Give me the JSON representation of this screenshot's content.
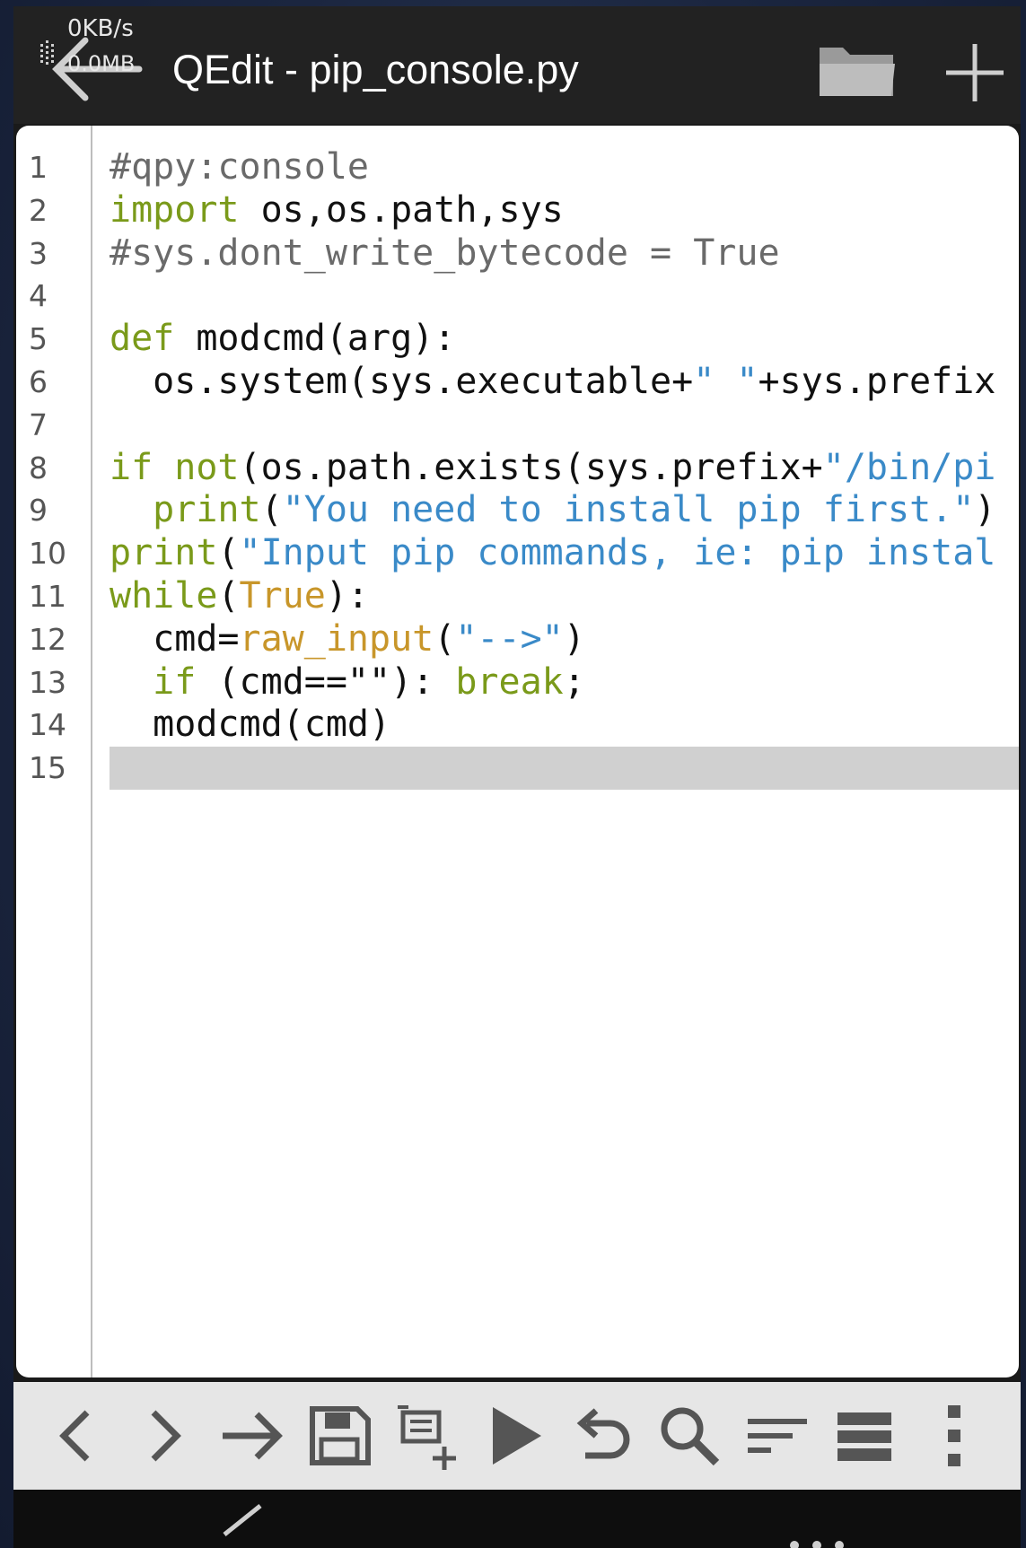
{
  "status": {
    "net_speed": "0KB/s",
    "net_total": "0.0MB"
  },
  "app": {
    "title": "QEdit - pip_console.py"
  },
  "icons": {
    "back": "back-arrow-icon",
    "folder": "folder-icon",
    "add": "plus-icon"
  },
  "editor": {
    "current_line": 15,
    "lines": [
      {
        "n": "1"
      },
      {
        "n": "2"
      },
      {
        "n": "3"
      },
      {
        "n": "4"
      },
      {
        "n": "5"
      },
      {
        "n": "6"
      },
      {
        "n": "7"
      },
      {
        "n": "8"
      },
      {
        "n": "9"
      },
      {
        "n": "10"
      },
      {
        "n": "11"
      },
      {
        "n": "12"
      },
      {
        "n": "13"
      },
      {
        "n": "14"
      },
      {
        "n": "15"
      }
    ],
    "code": {
      "l1_comment": "#qpy:console",
      "l2_kw": "import",
      "l2_rest": " os,os.path,sys",
      "l3_comment": "#sys.dont_write_bytecode = True",
      "l5_kw": "def",
      "l5_rest": " modcmd(arg):",
      "l6_a": "  os.system(sys.executable+",
      "l6_str": "\" \"",
      "l6_b": "+sys.prefix",
      "l8_kw1": "if",
      "l8_sp": " ",
      "l8_kw2": "not",
      "l8_a": "(os.path.exists(sys.prefix+",
      "l8_str": "\"/bin/pi",
      "l9_ind": "  ",
      "l9_kw": "print",
      "l9_a": "(",
      "l9_str": "\"You need to install pip first.\"",
      "l9_b": ")",
      "l10_kw": "print",
      "l10_a": "(",
      "l10_str": "\"Input pip commands, ie: pip instal",
      "l11_kw": "while",
      "l11_a": "(",
      "l11_bi": "True",
      "l11_b": "):",
      "l12_a": "  cmd=",
      "l12_bi": "raw_input",
      "l12_b": "(",
      "l12_str": "\"-->\"",
      "l12_c": ")",
      "l13_ind": "  ",
      "l13_kw": "if",
      "l13_a": " (cmd==\"\"): ",
      "l13_kw2": "break",
      "l13_b": ";",
      "l14": "  modcmd(cmd)"
    }
  },
  "toolbar": {
    "buttons": [
      "chevron-left-icon",
      "chevron-right-icon",
      "arrow-right-icon",
      "save-icon",
      "select-add-icon",
      "play-icon",
      "undo-icon",
      "search-icon",
      "sort-lines-icon",
      "list-icon",
      "more-vert-icon"
    ]
  },
  "colors": {
    "keyword": "#7a9a1a",
    "comment": "#6a6a6a",
    "string": "#3a8ac8",
    "builtin": "#c8962a"
  }
}
